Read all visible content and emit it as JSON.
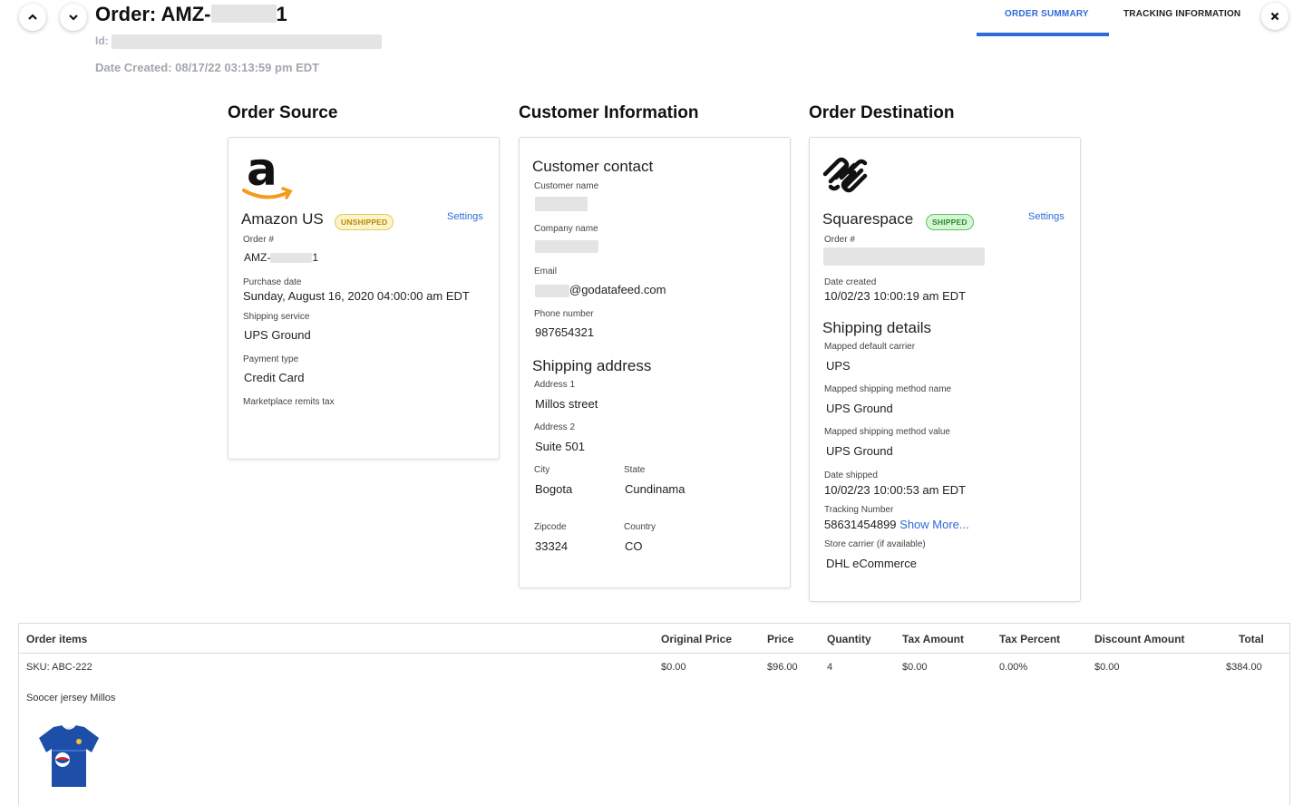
{
  "header": {
    "order_title_prefix": "Order: AMZ-",
    "order_title_suffix": "1",
    "id_label": "Id:",
    "date_created": "Date Created: 08/17/22 03:13:59 pm EDT",
    "tabs": [
      {
        "label": "ORDER SUMMARY",
        "active": true
      },
      {
        "label": "TRACKING INFORMATION",
        "active": false
      }
    ]
  },
  "sections": {
    "source": "Order Source",
    "customer": "Customer Information",
    "destination": "Order Destination"
  },
  "source": {
    "logo": "amazon-logo",
    "store_name": "Amazon US",
    "status": "UNSHIPPED",
    "settings_label": "Settings",
    "order_label": "Order #",
    "order_prefix": "AMZ-",
    "order_suffix": "1",
    "purchase_date_label": "Purchase date",
    "purchase_date": "Sunday, August 16, 2020 04:00:00 am EDT",
    "shipping_service_label": "Shipping service",
    "shipping_service": "UPS Ground",
    "payment_type_label": "Payment type",
    "payment_type": "Credit Card",
    "marketplace_label": "Marketplace remits tax"
  },
  "customer": {
    "contact_heading": "Customer contact",
    "name_label": "Customer name",
    "company_label": "Company name",
    "email_label": "Email",
    "email_domain": "@godatafeed.com",
    "phone_label": "Phone number",
    "phone": "987654321",
    "address_heading": "Shipping address",
    "address1_label": "Address 1",
    "address1": "Millos street",
    "address2_label": "Address 2",
    "address2": "Suite 501",
    "city_label": "City",
    "city": "Bogota",
    "state_label": "State",
    "state": "Cundinama",
    "zip_label": "Zipcode",
    "zip": "33324",
    "country_label": "Country",
    "country": "CO"
  },
  "destination": {
    "logo": "squarespace-logo",
    "store_name": "Squarespace",
    "status": "SHIPPED",
    "settings_label": "Settings",
    "order_label": "Order #",
    "date_created_label": "Date created",
    "date_created": "10/02/23 10:00:19 am EDT",
    "shipping_heading": "Shipping details",
    "carrier_label": "Mapped default carrier",
    "carrier": "UPS",
    "method_name_label": "Mapped shipping method name",
    "method_name": "UPS Ground",
    "method_value_label": "Mapped shipping method value",
    "method_value": "UPS Ground",
    "date_shipped_label": "Date shipped",
    "date_shipped": "10/02/23 10:00:53 am EDT",
    "tracking_label": "Tracking Number",
    "tracking_number": "58631454899",
    "show_more": "Show More...",
    "store_carrier_label": "Store carrier (if available)",
    "store_carrier": "DHL eCommerce"
  },
  "items": {
    "headers": [
      "Order items",
      "Original Price",
      "Price",
      "Quantity",
      "Tax Amount",
      "Tax Percent",
      "Discount Amount",
      "Total"
    ],
    "rows": [
      {
        "sku": "SKU: ABC-222",
        "original_price": "$0.00",
        "price": "$96.00",
        "quantity": "4",
        "tax_amount": "$0.00",
        "tax_percent": "0.00%",
        "discount_amount": "$0.00",
        "total": "$384.00",
        "name": "Soocer jersey Millos"
      }
    ]
  },
  "colors": {
    "accent": "#2d6bd8",
    "unshipped": "#e6c95a",
    "shipped": "#5cc45c"
  }
}
